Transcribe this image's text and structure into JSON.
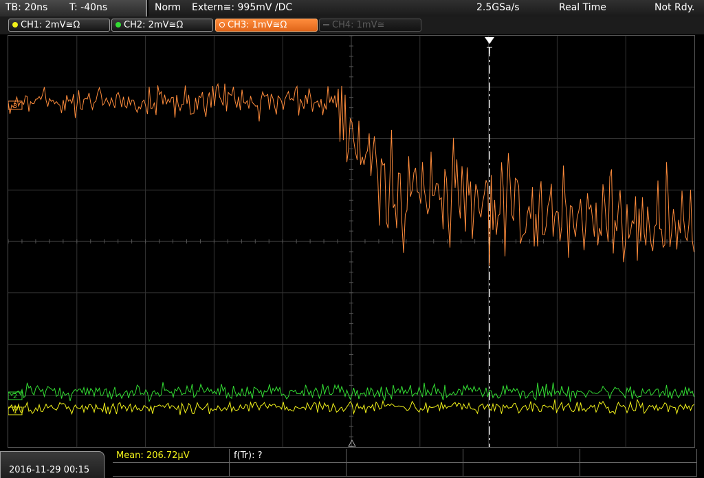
{
  "header": {
    "timebase": "TB: 20ns",
    "trigger_time": "T: -40ns",
    "trigger_mode": "Norm",
    "trigger_source": "Extern≅: 995mV ∕DC",
    "sample_rate": "2.5GSa/s",
    "acq_mode": "Real Time",
    "status": "Not Rdy."
  },
  "channels": [
    {
      "label": "CH1: 2mV≅Ω",
      "color": "#f2f21a",
      "state": "on"
    },
    {
      "label": "CH2: 2mV≅Ω",
      "color": "#33dd33",
      "state": "on"
    },
    {
      "label": "CH3: 1mV≅Ω",
      "color": "#ff8c3c",
      "state": "active"
    },
    {
      "label": "CH4: 1mV≅",
      "color": "#5c5c5c",
      "state": "off"
    }
  ],
  "trigger_marker_label": "T",
  "markers": {
    "ch3_level": "3",
    "ch1_level": "1",
    "ch2_level": "2"
  },
  "footer": {
    "datetime": "2016-11-29 00:15",
    "measurements": [
      {
        "text": "Mean: 206.72µV",
        "color": "#f2f21a"
      },
      {
        "text": "f(Tr): ?",
        "color": "#ffffff"
      }
    ]
  }
}
